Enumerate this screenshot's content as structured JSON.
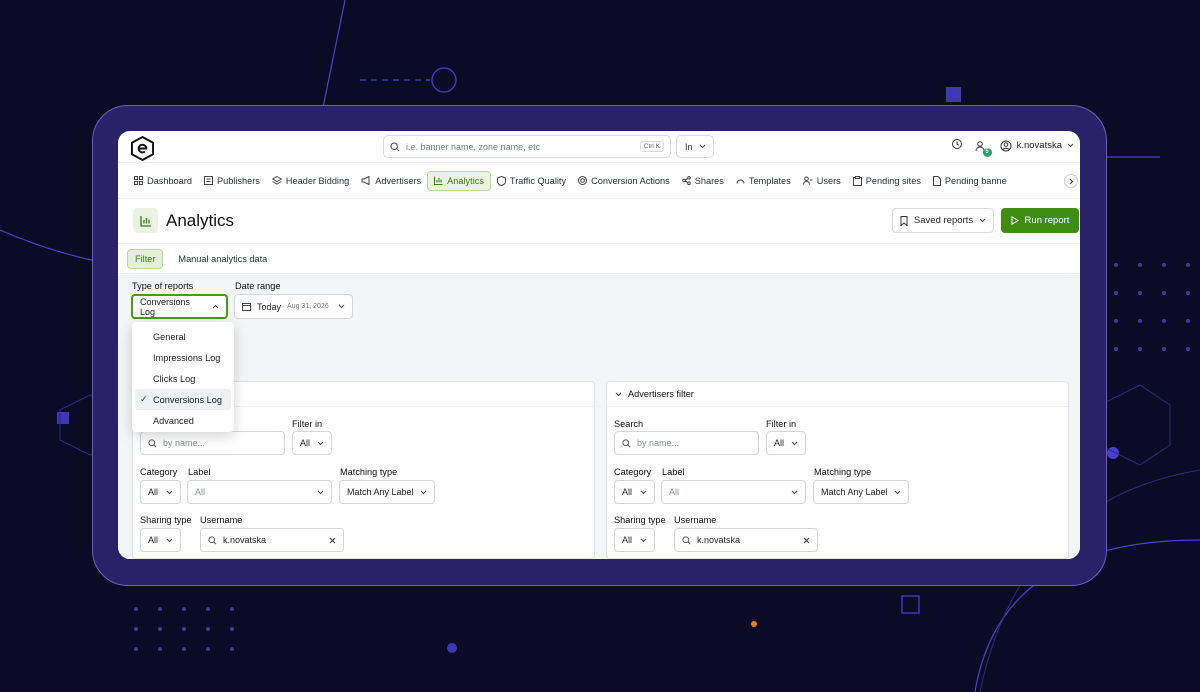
{
  "topbar": {
    "search_placeholder": "i.e. banner name, zone name, etc",
    "search_shortcut": "Ctrl K",
    "scope_select": "In",
    "notification_count": "5",
    "username": "k.novatska"
  },
  "nav": {
    "items": [
      {
        "label": "Dashboard",
        "icon": "grid-icon"
      },
      {
        "label": "Publishers",
        "icon": "publishers-icon"
      },
      {
        "label": "Header Bidding",
        "icon": "layers-icon"
      },
      {
        "label": "Advertisers",
        "icon": "megaphone-icon"
      },
      {
        "label": "Analytics",
        "icon": "bar-chart-icon",
        "active": true
      },
      {
        "label": "Traffic Quality",
        "icon": "shield-icon"
      },
      {
        "label": "Conversion Actions",
        "icon": "target-icon"
      },
      {
        "label": "Shares",
        "icon": "share-icon"
      },
      {
        "label": "Templates",
        "icon": "template-icon"
      },
      {
        "label": "Users",
        "icon": "users-icon"
      },
      {
        "label": "Pending sites",
        "icon": "clipboard-icon"
      },
      {
        "label": "Pending banne",
        "icon": "file-icon"
      }
    ]
  },
  "page": {
    "title": "Analytics",
    "saved_reports_label": "Saved reports",
    "run_report_label": "Run report"
  },
  "tabs": [
    {
      "label": "Filter",
      "active": true
    },
    {
      "label": "Manual analytics data"
    }
  ],
  "report_filters": {
    "type_label": "Type of reports",
    "type_value": "Conversions Log",
    "date_label": "Date range",
    "date_value": "Today",
    "date_detail": "Aug 31, 2026"
  },
  "report_type_options": [
    {
      "label": "General"
    },
    {
      "label": "Impressions Log"
    },
    {
      "label": "Clicks Log"
    },
    {
      "label": "Conversions Log",
      "selected": true
    },
    {
      "label": "Advanced"
    }
  ],
  "left_panel": {
    "filter_in_label": "Filter in",
    "search_placeholder": "by name...",
    "filter_in_value": "All",
    "category_label": "Category",
    "category_value": "All",
    "label_label": "Label",
    "label_value": "All",
    "matching_label": "Matching type",
    "matching_value": "Match Any Label",
    "sharing_label": "Sharing type",
    "sharing_value": "All",
    "username_label": "Username",
    "username_value": "k.novatska"
  },
  "right_panel": {
    "title": "Advertisers filter",
    "search_label": "Search",
    "search_placeholder": "by name...",
    "filter_in_label": "Filter in",
    "filter_in_value": "All",
    "category_label": "Category",
    "category_value": "All",
    "label_label": "Label",
    "label_value": "All",
    "matching_label": "Matching type",
    "matching_value": "Match Any Label",
    "sharing_label": "Sharing type",
    "sharing_value": "All",
    "username_label": "Username",
    "username_value": "k.novatska"
  },
  "colors": {
    "background": "#0c0b26",
    "frame": "#2a2168",
    "accent_green": "#3e8e12",
    "active_tab_bg": "#e9f3df"
  }
}
